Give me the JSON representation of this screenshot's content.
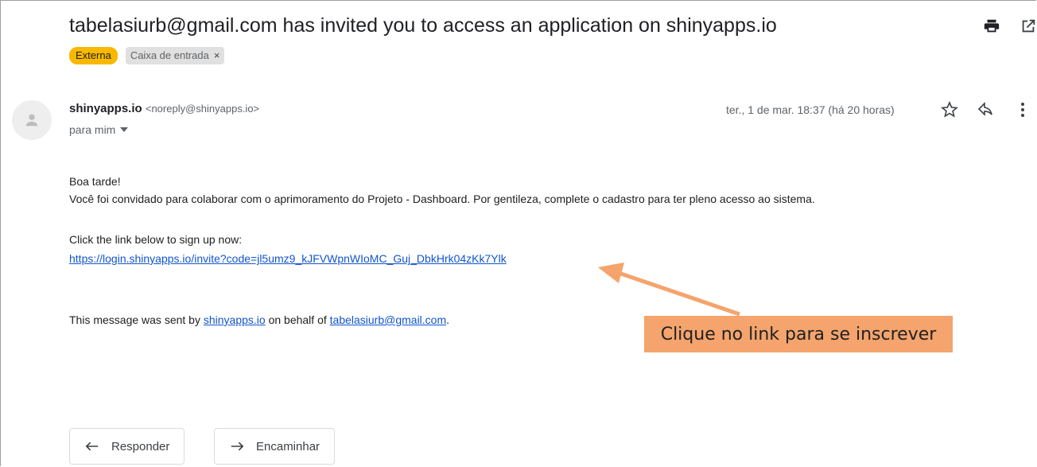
{
  "email": {
    "subject": "tabelasiurb@gmail.com has invited you to access an application on shinyapps.io",
    "labels": {
      "externa": "Externa",
      "inbox": "Caixa de entrada",
      "inbox_remove": "×"
    },
    "sender": {
      "name": "shinyapps.io",
      "email": "<noreply@shinyapps.io>",
      "to": "para mim"
    },
    "date": "ter., 1 de mar. 18:37 (há 20 horas)",
    "body": {
      "greeting": "Boa tarde!",
      "line1": "Você foi convidado para colaborar com o aprimoramento do Projeto - Dashboard. Por gentileza, complete o cadastro para ter pleno acesso ao sistema.",
      "signup_intro": "Click the link below to sign up now:",
      "signup_link": "https://login.shinyapps.io/invite?code=jl5umz9_kJFVWpnWIoMC_Guj_DbkHrk04zKk7Ylk",
      "footer_prefix": "This message was sent by ",
      "footer_link1": "shinyapps.io",
      "footer_middle": " on behalf of ",
      "footer_link2": "tabelasiurb@gmail.com",
      "footer_suffix": "."
    },
    "callout": "Clique no link para se inscrever",
    "actions": {
      "reply": "Responder",
      "forward": "Encaminhar"
    }
  },
  "colors": {
    "label_externa": "#f9b800",
    "link": "#1155cc",
    "callout": "#f4a46c"
  },
  "icons": [
    "print-icon",
    "open-in-new-window-icon",
    "avatar-icon",
    "dropdown-icon",
    "star-icon",
    "reply-icon",
    "more-vert-icon",
    "forward-icon"
  ]
}
